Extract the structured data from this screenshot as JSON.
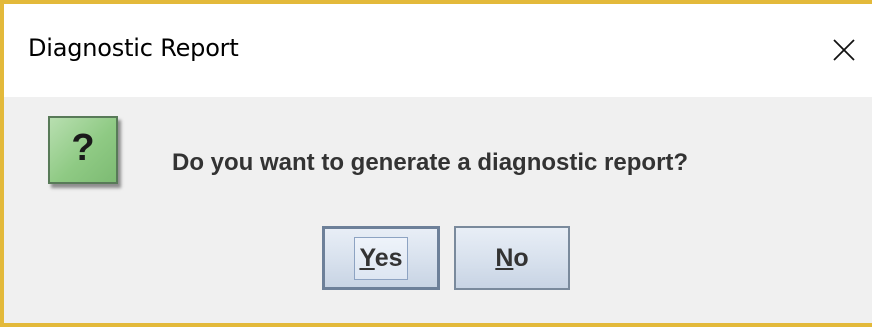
{
  "dialog": {
    "title": "Diagnostic Report",
    "close_icon": "close-x-icon",
    "message_icon": "question-icon",
    "message_icon_glyph": "?",
    "message": "Do you want to generate a diagnostic report?",
    "buttons": {
      "yes": {
        "mnemonic": "Y",
        "rest": "es"
      },
      "no": {
        "mnemonic": "N",
        "rest": "o"
      }
    },
    "colors": {
      "window_border": "#e3b93a",
      "icon_background": "#8fca84",
      "button_border": "#7a8a9c"
    }
  }
}
